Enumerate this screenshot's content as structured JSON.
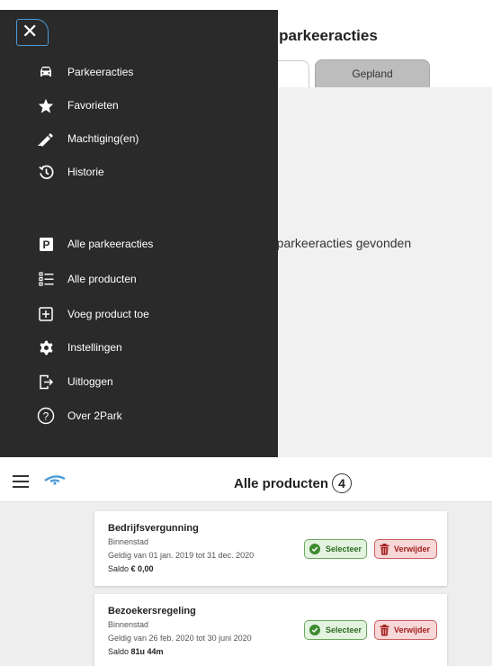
{
  "top_screen": {
    "title_fragment": "e parkeeracties",
    "tabs": [
      {
        "label": ""
      },
      {
        "label": "Gepland"
      }
    ],
    "empty_message": "e parkeeracties gevonden"
  },
  "drawer": {
    "close_icon": "close-icon",
    "items": [
      {
        "label": "Parkeeracties",
        "icon": "car-icon"
      },
      {
        "label": "Favorieten",
        "icon": "star-icon"
      },
      {
        "label": "Machtiging(en)",
        "icon": "pen-icon"
      },
      {
        "label": "Historie",
        "icon": "history-icon"
      },
      {
        "label": "Alle parkeeracties",
        "icon": "parking-icon"
      },
      {
        "label": "Alle producten",
        "icon": "list-icon"
      },
      {
        "label": "Voeg product toe",
        "icon": "add-box-icon"
      },
      {
        "label": "Instellingen",
        "icon": "gear-icon"
      },
      {
        "label": "Uitloggen",
        "icon": "logout-icon"
      },
      {
        "label": "Over 2Park",
        "icon": "help-icon"
      }
    ]
  },
  "bottom_screen": {
    "title": "Alle producten",
    "count": "4",
    "products": [
      {
        "name": "Bedrijfsvergunning",
        "area": "Binnenstad",
        "validity": "Geldig van 01 jan. 2019 tot 31 dec. 2020",
        "saldo_label": "Saldo",
        "saldo_value": "€ 0,00",
        "select_label": "Selecteer",
        "delete_label": "Verwijder"
      },
      {
        "name": "Bezoekersregeling",
        "area": "Binnenstad",
        "validity": "Geldig van 26 feb. 2020 tot 30 juni 2020",
        "saldo_label": "Saldo",
        "saldo_value": "81u 44m",
        "select_label": "Selecteer",
        "delete_label": "Verwijder"
      }
    ]
  },
  "colors": {
    "drawer_bg": "#2a2a2a",
    "accent_blue": "#4a9ad8",
    "select_green": "#3d8a2f",
    "delete_red": "#a32020"
  }
}
